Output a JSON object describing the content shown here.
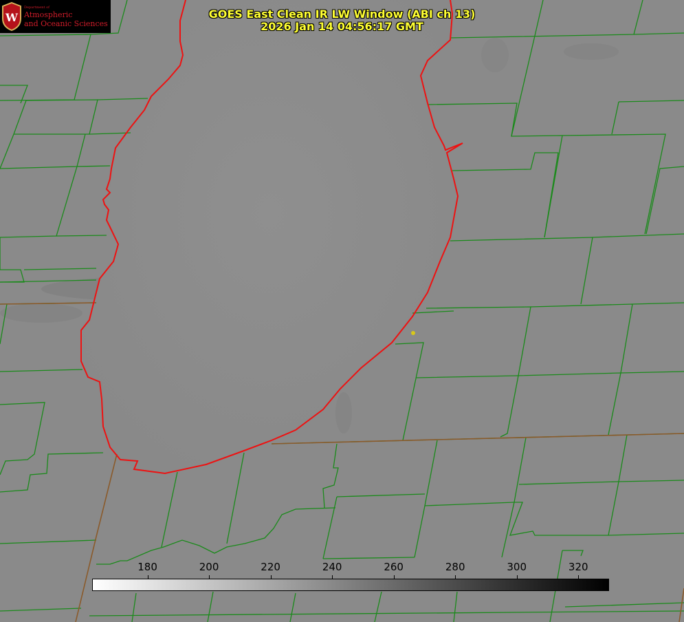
{
  "title": {
    "line1": "GOES East Clean IR LW Window (ABI ch 13)",
    "line2": "2026 Jan 14 04:56:17 GMT"
  },
  "logo": {
    "department": "Department of",
    "line1": "Atmospheric",
    "line2": "and Oceanic Sciences",
    "seal_letter": "W"
  },
  "colorbar": {
    "min": 162,
    "max": 330,
    "ticks": [
      "180",
      "200",
      "220",
      "240",
      "260",
      "280",
      "300",
      "320"
    ],
    "tick_values": [
      180,
      200,
      220,
      240,
      260,
      280,
      300,
      320
    ],
    "start_color": "#ffffff",
    "end_color": "#000000"
  },
  "colors": {
    "county_lines": "#1a8a1a",
    "state_lines": "#8a5a2a",
    "lake_shore": "#ee1111",
    "station_marker": "#d8c81a",
    "title_text": "#ffff33"
  }
}
